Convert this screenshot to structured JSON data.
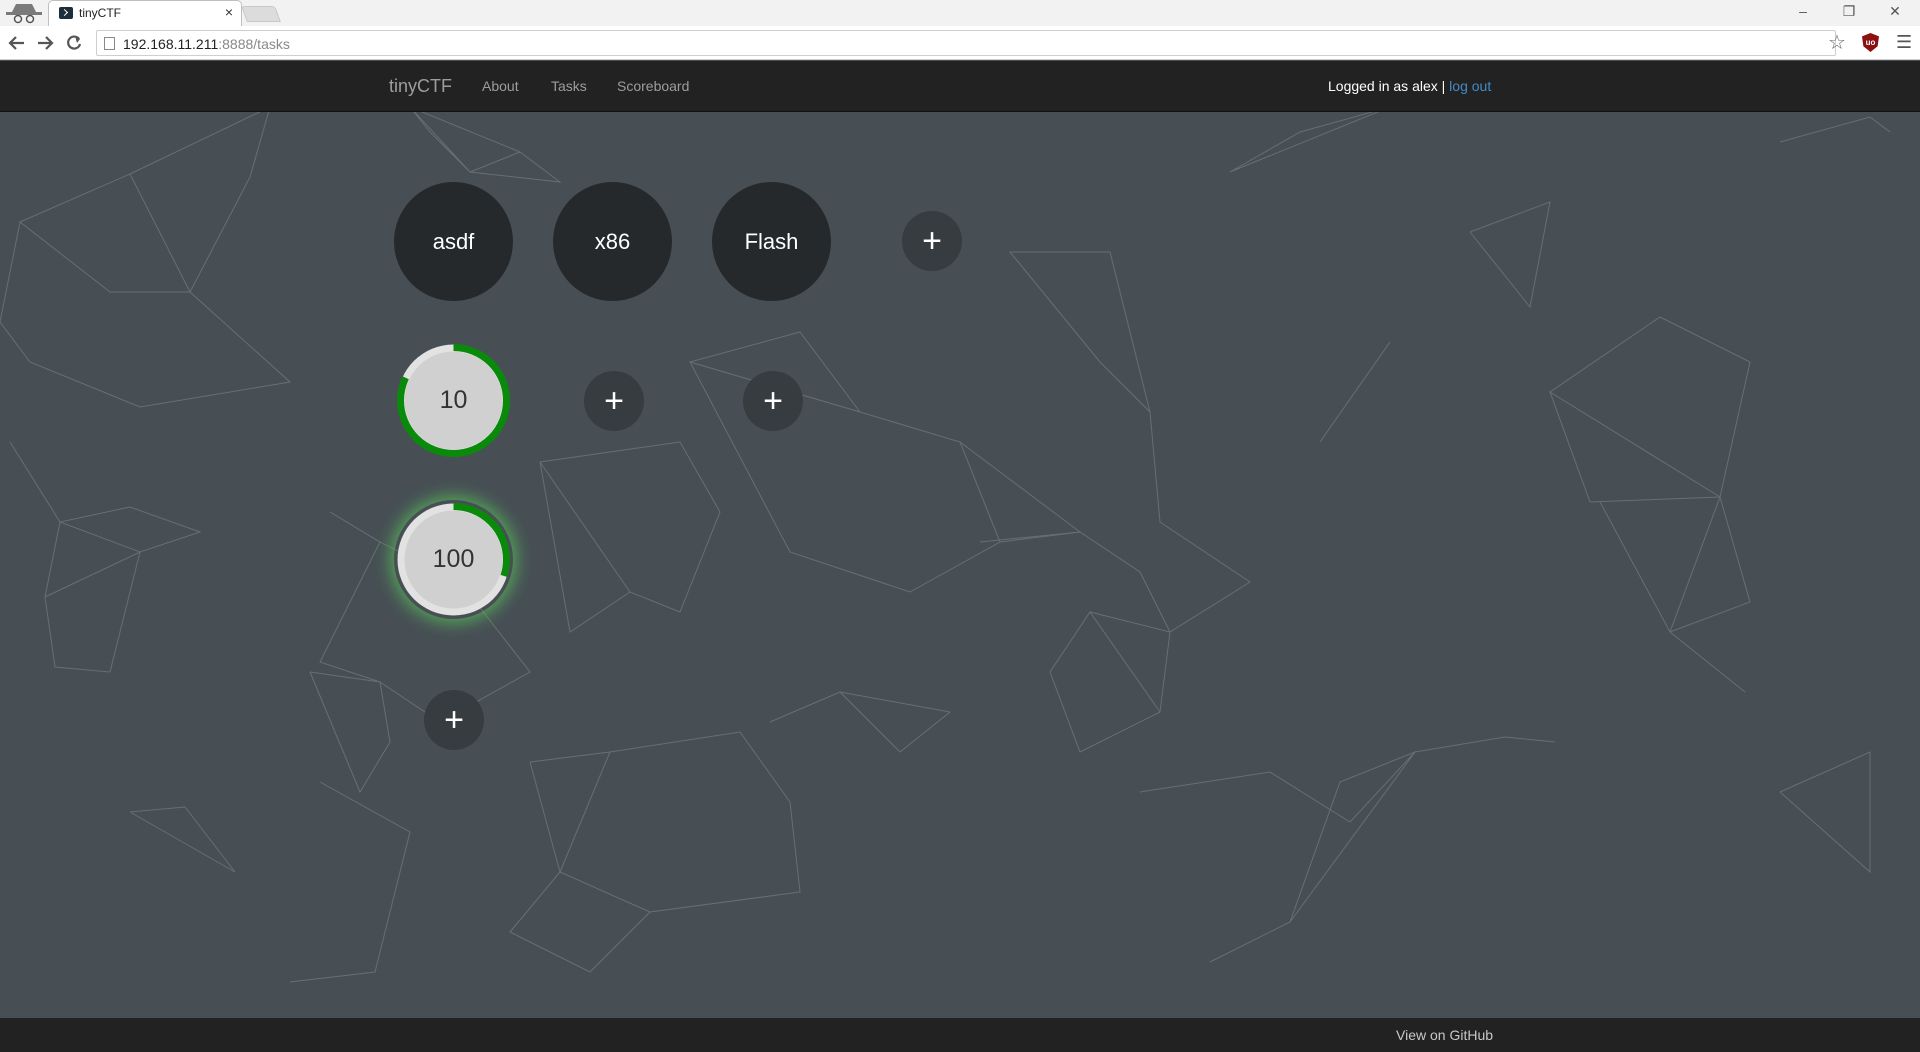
{
  "browser": {
    "tab_title": "tinyCTF",
    "tab_close": "×",
    "url_host": "192.168.11.211",
    "url_rest": ":8888/tasks",
    "window_controls": [
      "–",
      "❐",
      "✕"
    ],
    "nav_icons": [
      "back-icon",
      "forward-icon",
      "reload-icon"
    ]
  },
  "nav": {
    "brand": "tinyCTF",
    "links": [
      "About",
      "Tasks",
      "Scoreboard"
    ],
    "login_text": "Logged in as alex | ",
    "logout": "log out"
  },
  "categories": [
    "asdf",
    "x86",
    "Flash"
  ],
  "add_label": "+",
  "tasks": [
    {
      "label": "10",
      "progress": 0.82
    },
    {
      "label": "100",
      "progress": 0.3
    }
  ],
  "footer": {
    "github": "View on GitHub"
  },
  "colors": {
    "page_bg": "#474f55",
    "navbar": "#222222",
    "category_bg": "#25292c",
    "add_bg": "#363c40",
    "task_fill": "#d0d0d0",
    "progress": "#0a8a0a",
    "link": "#428bca"
  }
}
